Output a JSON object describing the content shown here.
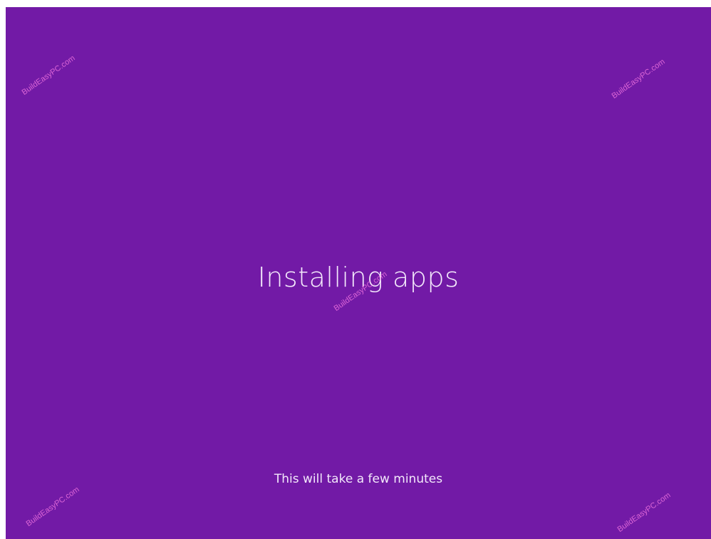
{
  "screen": {
    "background_color": "#721aa6",
    "text_color": "#f3e8fb",
    "title": "Installing apps",
    "subtitle": "This will take a few minutes"
  },
  "watermark": {
    "text": "BuildEasyPC.com",
    "color": "#ff7fe6"
  }
}
